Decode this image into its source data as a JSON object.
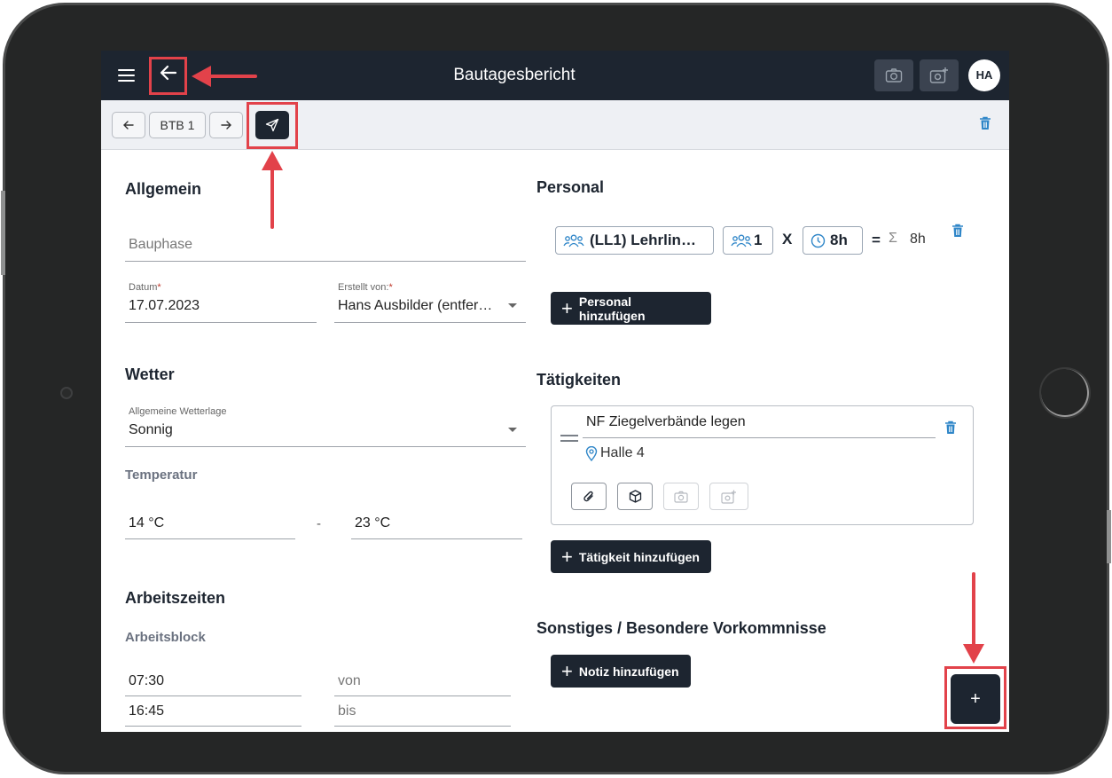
{
  "app": {
    "title": "Bautagesbericht",
    "avatar_initials": "HA"
  },
  "toolbar": {
    "report_label": "BTB 1"
  },
  "allgemein": {
    "title": "Allgemein",
    "bauphase_placeholder": "Bauphase",
    "datum_label": "Datum",
    "datum_value": "17.07.2023",
    "erstellt_label": "Erstellt von:",
    "erstellt_value": "Hans Ausbilder (entfer…",
    "required_mark": "*"
  },
  "wetter": {
    "title": "Wetter",
    "wetterlage_label": "Allgemeine Wetterlage",
    "wetterlage_value": "Sonnig",
    "temperatur_title": "Temperatur",
    "temp_min": "14 °C",
    "temp_separator": "-",
    "temp_max": "23 °C"
  },
  "arbeitszeiten": {
    "title": "Arbeitszeiten",
    "block_title": "Arbeitsblock",
    "von_value": "07:30",
    "von_label": "von",
    "bis_value": "16:45",
    "bis_label": "bis"
  },
  "personal": {
    "title": "Personal",
    "role_chip": "(LL1) Lehrlin…",
    "count_chip": "1",
    "multiply": "X",
    "hours_chip": "8h",
    "equals": "=",
    "sum_symbol": "Σ",
    "sum_value": "8h",
    "add_label": "Personal hinzufügen"
  },
  "taetigkeiten": {
    "title": "Tätigkeiten",
    "activity_name": "NF Ziegelverbände legen",
    "location": "Halle 4",
    "add_label": "Tätigkeit hinzufügen"
  },
  "sonstiges": {
    "title": "Sonstiges / Besondere Vorkommnisse",
    "add_label": "Notiz hinzufügen"
  },
  "fab": {
    "label": "+"
  },
  "colors": {
    "header_bg": "#1d2530",
    "accent_blue": "#2f86c8",
    "annotation_red": "#e2424a"
  }
}
